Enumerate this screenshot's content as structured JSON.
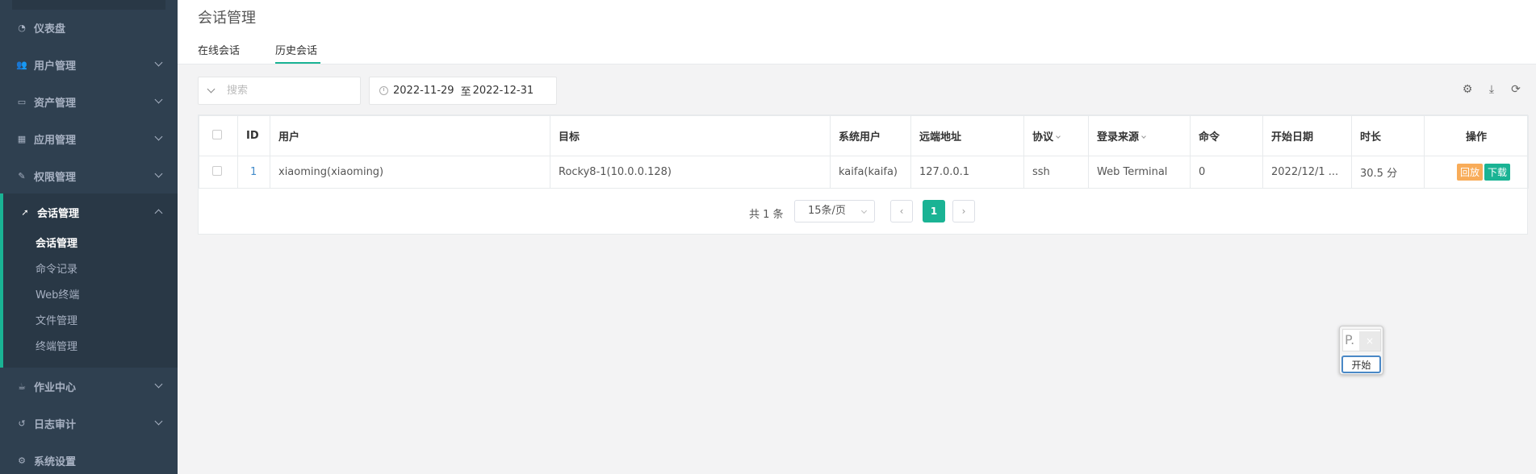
{
  "sidebar": {
    "items": [
      {
        "label": "仪表盘",
        "icon": "dashboard-icon"
      },
      {
        "label": "用户管理",
        "icon": "users-icon"
      },
      {
        "label": "资产管理",
        "icon": "inbox-icon"
      },
      {
        "label": "应用管理",
        "icon": "th-icon"
      },
      {
        "label": "权限管理",
        "icon": "edit-icon"
      },
      {
        "label": "会话管理",
        "icon": "rocket-icon"
      },
      {
        "label": "作业中心",
        "icon": "coffee-icon"
      },
      {
        "label": "日志审计",
        "icon": "history-icon"
      },
      {
        "label": "系统设置",
        "icon": "gears-icon"
      }
    ],
    "sub_items": [
      "会话管理",
      "命令记录",
      "Web终端",
      "文件管理",
      "终端管理"
    ]
  },
  "header": {
    "title": "会话管理",
    "tabs": [
      "在线会话",
      "历史会话"
    ]
  },
  "toolbar": {
    "search_placeholder": "搜索",
    "date_start": "2022-11-29",
    "date_sep": "至",
    "date_end": "2022-12-31"
  },
  "table": {
    "headers": [
      "ID",
      "用户",
      "目标",
      "系统用户",
      "远端地址",
      "协议",
      "登录来源",
      "命令",
      "开始日期",
      "时长",
      "操作"
    ],
    "rows": [
      {
        "id": "1",
        "user": "xiaoming(xiaoming)",
        "target": "Rocky8-1(10.0.0.128)",
        "system_user": "kaifa(kaifa)",
        "remote_addr": "127.0.0.1",
        "protocol": "ssh",
        "login_from": "Web Terminal",
        "commands": "0",
        "start_date": "2022/12/1 ...",
        "duration": "30.5 分",
        "actions": {
          "replay": "回放",
          "download": "下载"
        }
      }
    ]
  },
  "pagination": {
    "total": "共 1 条",
    "page_size": "15条/页",
    "current_page": "1"
  },
  "float_widget": {
    "field_text": "P.",
    "close": "×",
    "start": "开始"
  },
  "colors": {
    "sidebar_bg": "#2f4050",
    "accent": "#1ab394",
    "replay_btn": "#f8ac59",
    "download_btn": "#1ab394"
  }
}
